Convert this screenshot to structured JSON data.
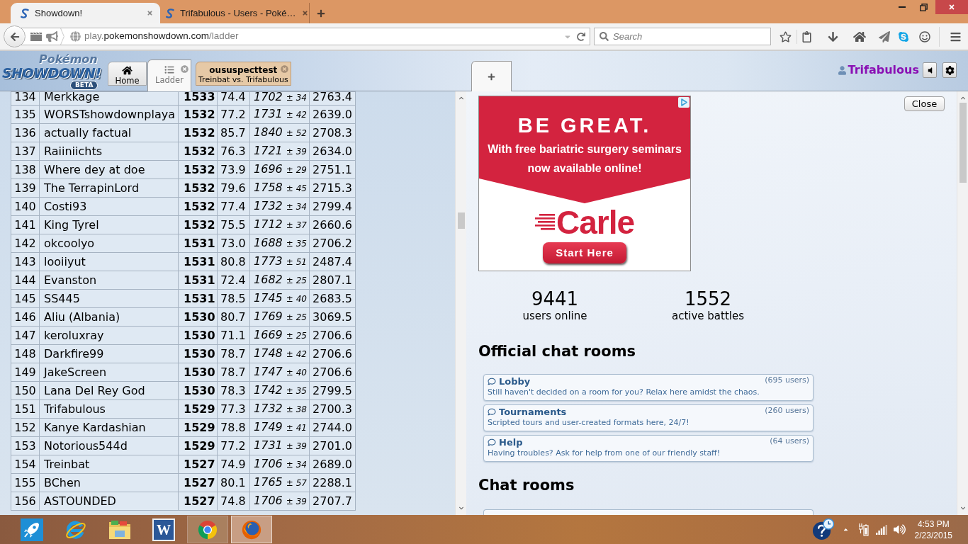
{
  "browser": {
    "tabs": [
      {
        "title": "Showdown!",
        "selected": true
      },
      {
        "title": "Trifabulous - Users - Poké…",
        "selected": false
      }
    ],
    "url": {
      "prefix": "play.",
      "domain": "pokemonshowdown.com",
      "path": "/ladder"
    },
    "search": {
      "placeholder": "Search"
    }
  },
  "header": {
    "logo": {
      "top": "Pokémon",
      "main": "SHOWDOWN!",
      "badge": "BETA"
    },
    "tabs": [
      {
        "kind": "home",
        "label": "Home",
        "selected": false,
        "closable": false,
        "notifying": false
      },
      {
        "kind": "ladder",
        "label": "Ladder",
        "selected": true,
        "closable": true,
        "notifying": false
      },
      {
        "kind": "battle",
        "label": "oususpecttest",
        "subtitle": "Treinbat vs. Trifabulous",
        "selected": false,
        "closable": true,
        "notifying": true
      }
    ],
    "right_tabs": [
      {
        "kind": "new",
        "selected": true
      }
    ],
    "user": {
      "name": "Trifabulous",
      "muted": false
    }
  },
  "ladder": {
    "rows": [
      {
        "rank": "134",
        "name": "Merkkage",
        "elo": "1533",
        "gxe": "74.4",
        "glicko": "1702",
        "deviation": "± 34",
        "coil": "2763.4"
      },
      {
        "rank": "135",
        "name": "WORSTshowdownplaya",
        "elo": "1532",
        "gxe": "77.2",
        "glicko": "1731",
        "deviation": "± 42",
        "coil": "2639.0"
      },
      {
        "rank": "136",
        "name": "actually factual",
        "elo": "1532",
        "gxe": "85.7",
        "glicko": "1840",
        "deviation": "± 52",
        "coil": "2708.3"
      },
      {
        "rank": "137",
        "name": "Raiiniichts",
        "elo": "1532",
        "gxe": "76.3",
        "glicko": "1721",
        "deviation": "± 39",
        "coil": "2634.0"
      },
      {
        "rank": "138",
        "name": "Where dey at doe",
        "elo": "1532",
        "gxe": "73.9",
        "glicko": "1696",
        "deviation": "± 29",
        "coil": "2751.1"
      },
      {
        "rank": "139",
        "name": "The TerrapinLord",
        "elo": "1532",
        "gxe": "79.6",
        "glicko": "1758",
        "deviation": "± 45",
        "coil": "2715.3"
      },
      {
        "rank": "140",
        "name": "Costi93",
        "elo": "1532",
        "gxe": "77.4",
        "glicko": "1732",
        "deviation": "± 34",
        "coil": "2799.4"
      },
      {
        "rank": "141",
        "name": "King Tyrel",
        "elo": "1532",
        "gxe": "75.5",
        "glicko": "1712",
        "deviation": "± 37",
        "coil": "2660.6"
      },
      {
        "rank": "142",
        "name": "okcoolyo",
        "elo": "1531",
        "gxe": "73.0",
        "glicko": "1688",
        "deviation": "± 35",
        "coil": "2706.2"
      },
      {
        "rank": "143",
        "name": "looiiyut",
        "elo": "1531",
        "gxe": "80.8",
        "glicko": "1773",
        "deviation": "± 51",
        "coil": "2487.4"
      },
      {
        "rank": "144",
        "name": "Evanston",
        "elo": "1531",
        "gxe": "72.4",
        "glicko": "1682",
        "deviation": "± 25",
        "coil": "2807.1"
      },
      {
        "rank": "145",
        "name": "SS445",
        "elo": "1531",
        "gxe": "78.5",
        "glicko": "1745",
        "deviation": "± 40",
        "coil": "2683.5"
      },
      {
        "rank": "146",
        "name": "Aliu (Albania)",
        "elo": "1530",
        "gxe": "80.7",
        "glicko": "1769",
        "deviation": "± 25",
        "coil": "3069.5"
      },
      {
        "rank": "147",
        "name": "keroluxray",
        "elo": "1530",
        "gxe": "71.1",
        "glicko": "1669",
        "deviation": "± 25",
        "coil": "2706.6"
      },
      {
        "rank": "148",
        "name": "Darkfire99",
        "elo": "1530",
        "gxe": "78.7",
        "glicko": "1748",
        "deviation": "± 42",
        "coil": "2706.6"
      },
      {
        "rank": "149",
        "name": "JakeScreen",
        "elo": "1530",
        "gxe": "78.7",
        "glicko": "1747",
        "deviation": "± 40",
        "coil": "2706.6"
      },
      {
        "rank": "150",
        "name": "Lana Del Rey God",
        "elo": "1530",
        "gxe": "78.3",
        "glicko": "1742",
        "deviation": "± 35",
        "coil": "2799.5"
      },
      {
        "rank": "151",
        "name": "Trifabulous",
        "elo": "1529",
        "gxe": "77.3",
        "glicko": "1732",
        "deviation": "± 38",
        "coil": "2700.3"
      },
      {
        "rank": "152",
        "name": "Kanye Kardashian",
        "elo": "1529",
        "gxe": "78.8",
        "glicko": "1749",
        "deviation": "± 41",
        "coil": "2744.0"
      },
      {
        "rank": "153",
        "name": "Notorious544d",
        "elo": "1529",
        "gxe": "77.2",
        "glicko": "1731",
        "deviation": "± 39",
        "coil": "2701.0"
      },
      {
        "rank": "154",
        "name": "Treinbat",
        "elo": "1527",
        "gxe": "74.9",
        "glicko": "1706",
        "deviation": "± 34",
        "coil": "2689.0"
      },
      {
        "rank": "155",
        "name": "BChen",
        "elo": "1527",
        "gxe": "80.1",
        "glicko": "1765",
        "deviation": "± 57",
        "coil": "2288.1"
      },
      {
        "rank": "156",
        "name": "ASTOUNDED",
        "elo": "1527",
        "gxe": "74.8",
        "glicko": "1706",
        "deviation": "± 39",
        "coil": "2707.7"
      }
    ]
  },
  "side": {
    "close": "Close",
    "ad": {
      "headline": "BE GREAT.",
      "text_lines": [
        "With free bariatric surgery seminars",
        "now available online!"
      ],
      "brand": "Carle",
      "button": "Start Here"
    },
    "stats": [
      {
        "value": "9441",
        "label": "users online"
      },
      {
        "value": "1552",
        "label": "active battles"
      }
    ],
    "sections": [
      {
        "title": "Official chat rooms",
        "more_below": false,
        "rooms": [
          {
            "name": "Lobby",
            "users": "(695 users)",
            "description": "Still haven't decided on a room for you? Relax here amidst the chaos."
          },
          {
            "name": "Tournaments",
            "users": "(260 users)",
            "description": "Scripted tours and user-created formats here, 24/7!"
          },
          {
            "name": "Help",
            "users": "(64 users)",
            "description": "Having troubles? Ask for help from one of our friendly staff!"
          }
        ]
      },
      {
        "title": "Chat rooms",
        "more_below": true
      }
    ]
  },
  "taskbar": {
    "apps": [
      {
        "kind": "rocket",
        "running": false,
        "active": false
      },
      {
        "kind": "ie",
        "running": false,
        "active": false
      },
      {
        "kind": "folder",
        "running": false,
        "active": false
      },
      {
        "kind": "word",
        "letter": "W",
        "running": false,
        "active": false
      },
      {
        "kind": "chrome",
        "running": true,
        "active": false
      },
      {
        "kind": "firefox",
        "running": true,
        "active": true
      }
    ],
    "clock": {
      "time": "4:53 PM",
      "date": "2/23/2015"
    }
  }
}
